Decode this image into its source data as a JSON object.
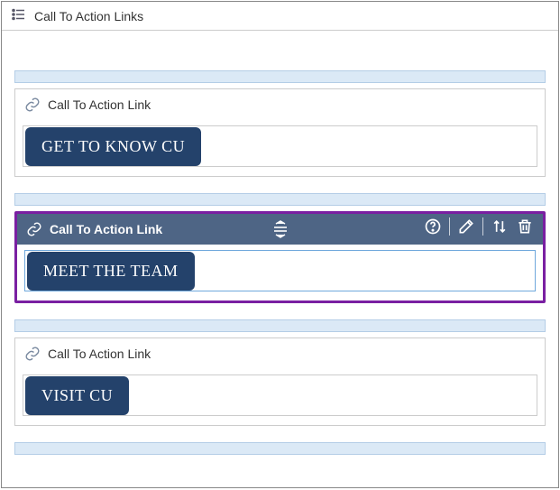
{
  "page": {
    "title": "Call To Action Links"
  },
  "blocks": [
    {
      "label": "Call To Action Link",
      "button_text": "GET TO KNOW CU",
      "selected": false
    },
    {
      "label": "Call To Action Link",
      "button_text": "MEET THE TEAM",
      "selected": true
    },
    {
      "label": "Call To Action Link",
      "button_text": "VISIT CU",
      "selected": false
    }
  ],
  "icons": {
    "list": "list-icon",
    "link": "link-icon",
    "help": "help-icon",
    "edit": "edit-icon",
    "sort": "sort-icon",
    "trash": "trash-icon",
    "drag": "drag-icon"
  }
}
